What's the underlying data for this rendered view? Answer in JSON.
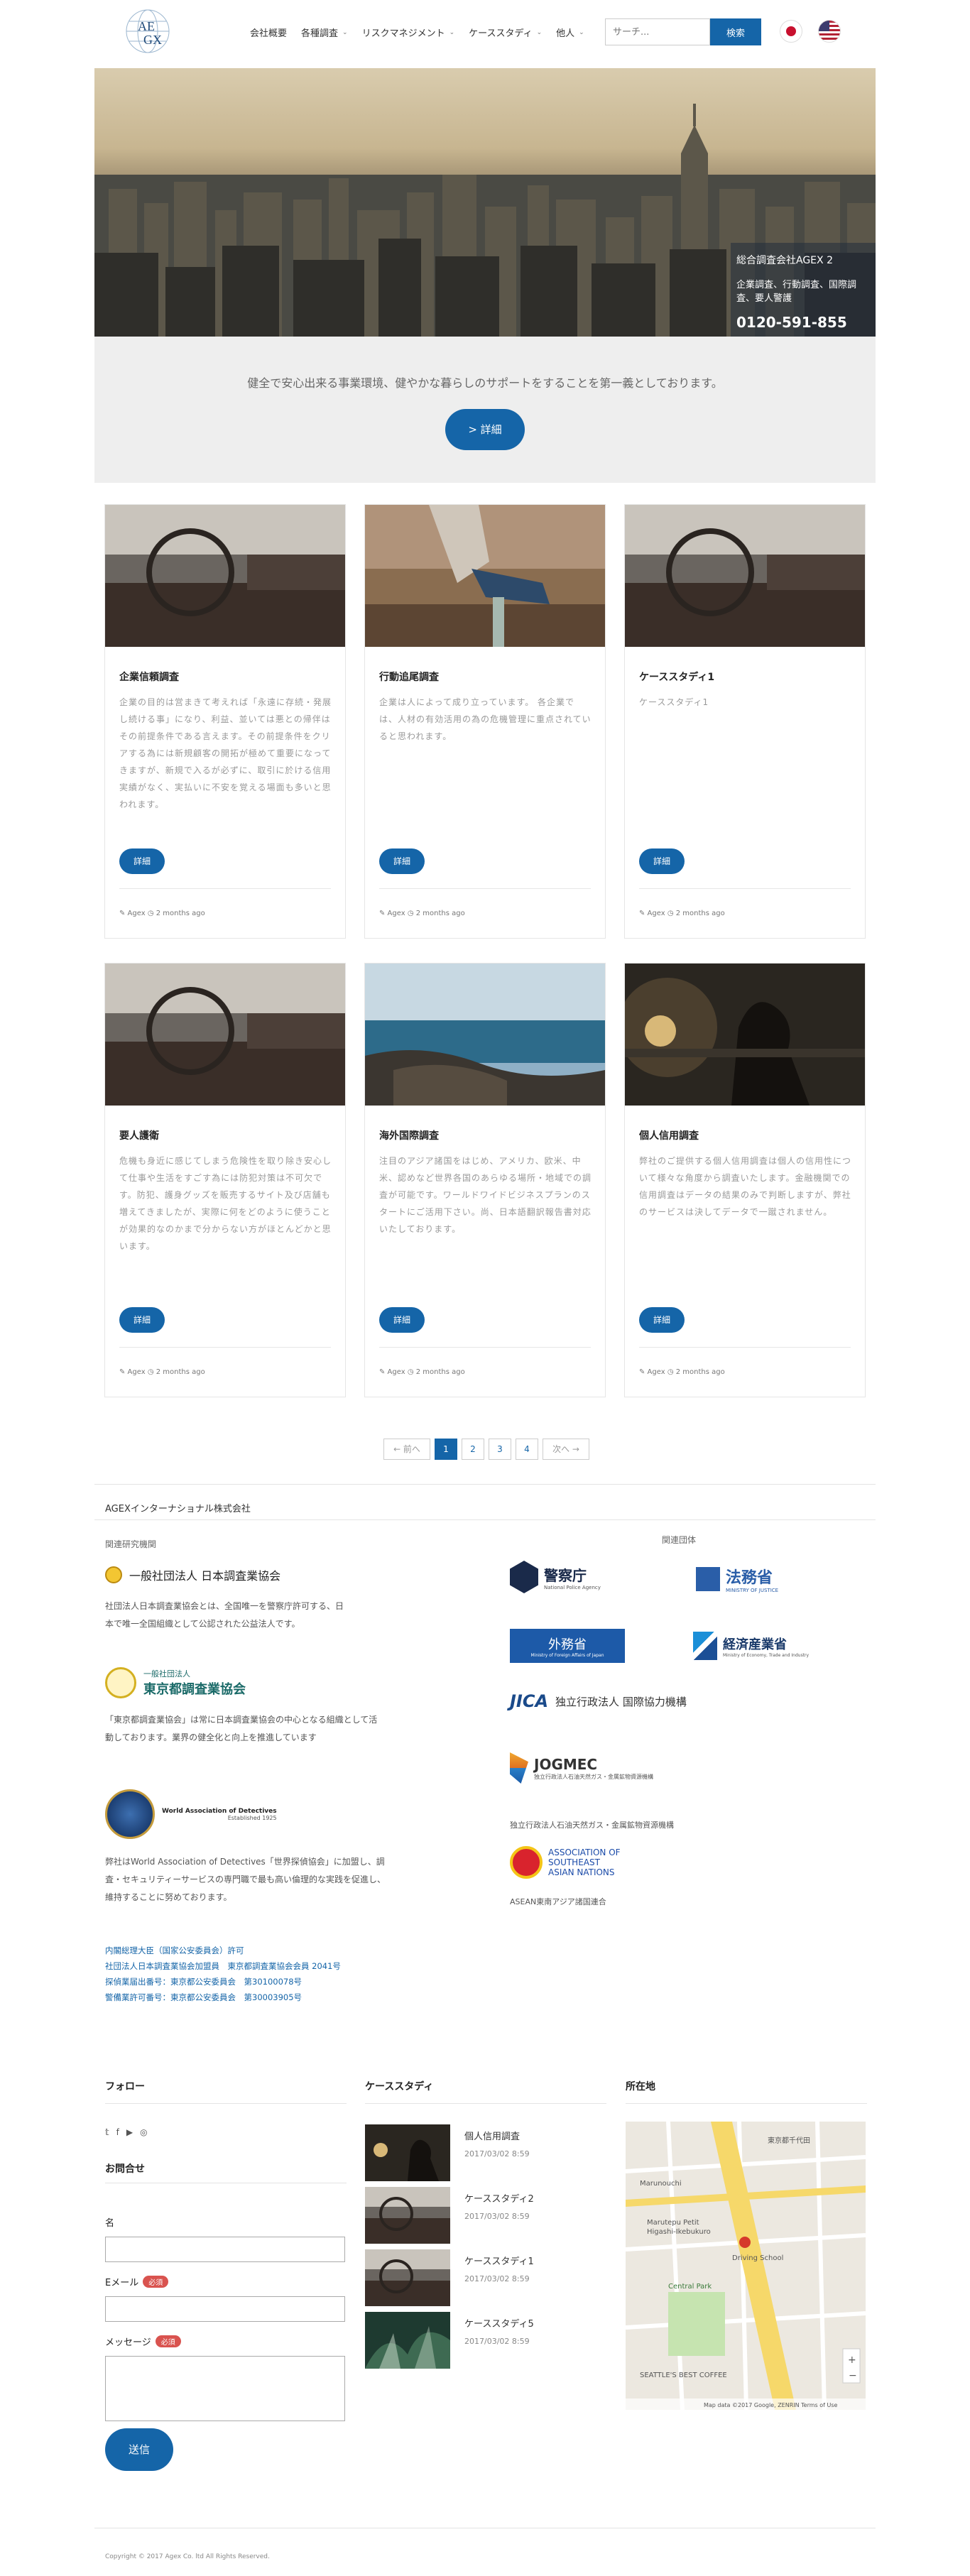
{
  "header": {
    "logo_text": "AEGX",
    "nav": [
      {
        "label": "会社概要",
        "has_menu": false
      },
      {
        "label": "各種調査",
        "has_menu": true
      },
      {
        "label": "リスクマネジメント",
        "has_menu": true
      },
      {
        "label": "ケーススタディ",
        "has_menu": true
      },
      {
        "label": "他人",
        "has_menu": true
      }
    ],
    "search_placeholder": "サーチ...",
    "search_button": "検索"
  },
  "hero": {
    "company": "総合調査会社AGEX 2",
    "services": "企業調査、行動調査、国際調査、要人警護",
    "phone": "0120-591-855",
    "tagline": "健全で安心出来る事業環境、健やかな暮らしのサポートをすることを第一義としております。",
    "detail_button": "> 詳細"
  },
  "cards": [
    {
      "title": "企業信頼調査",
      "excerpt": "企業の目的は営まきて考えれば「永遠に存続・発展し続ける事」になり、利益、並いては悪との帰伴はその前提条件である言えます。その前提条件をクリアする為には新規顧客の開拓が極めて重要になってきますが、新規で入るが必ずに、取引に於ける信用実績がなく、実払いに不安を覚える場面も多いと思われます。",
      "more": "詳細",
      "meta": "✎ Agex ◷ 2 months ago"
    },
    {
      "title": "行動追尾調査",
      "excerpt": "企業は人によって成り立っています。 各企業では、人材の有効活用の為の危機管理に重点されていると思われます。",
      "more": "詳細",
      "meta": "✎ Agex ◷ 2 months ago"
    },
    {
      "title": "ケーススタディ1",
      "excerpt": "ケーススタディ1",
      "more": "詳細",
      "meta": "✎ Agex ◷ 2 months ago"
    },
    {
      "title": "要人護衛",
      "excerpt": "危機も身近に感じてしまう危険性を取り除き安心して仕事や生活をすごす為には防犯対策は不可欠です。防犯、護身グッズを販売するサイト及び店舗も増えてきましたが、実際に何をどのように使うことが効果的なのかまで分からない方がほとんどかと思います。",
      "more": "詳細",
      "meta": "✎ Agex ◷ 2 months ago"
    },
    {
      "title": "海外国際調査",
      "excerpt": "注目のアジア諸国をはじめ、アメリカ、欧米、中米、認めなど世界各国のあらゆる場所・地域での調査が可能です。ワールドワイドビジネスプランのスタートにご活用下さい。尚、日本語翻訳報告書対応いたしております。",
      "more": "詳細",
      "meta": "✎ Agex ◷ 2 months ago"
    },
    {
      "title": "個人信用調査",
      "excerpt": "弊社のご提供する個人信用調査は個人の信用性について様々な角度から調査いたします。金融機関での信用調査はデータの結果のみで判断しますが、弊社のサービスは決してデータで一蹴されません。",
      "more": "詳細",
      "meta": "✎ Agex ◷ 2 months ago"
    }
  ],
  "pagination": {
    "prev": "← 前へ",
    "pages": [
      "1",
      "2",
      "3",
      "4"
    ],
    "current": "1",
    "next": "次へ →"
  },
  "associations": {
    "company": "AGEXインターナショナル株式会社",
    "related_heading": "関連研究機関",
    "groups_heading": "関連団体",
    "jrca_name": "一般社団法人 日本調査業協会",
    "jrca_text": "社団法人日本調査業協会とは、全国唯一を警察庁許可する、日本で唯一全国組織として公認された公益法人です。",
    "tokyo_small": "一般社団法人",
    "tokyo_name": "東京都調査業協会",
    "tokyo_text": "「東京都調査業協会」は常に日本調査業協会の中心となる組織として活動しております。業界の健全化と向上を推進しています",
    "wad_name": "World Association of Detectives",
    "wad_est": "Established 1925",
    "wad_text": "弊社はWorld Association of Detectives「世界探偵協会」に加盟し、調査・セキュリティーサービスの専門職で最も高い倫理的な実践を促進し、維持することに努めております。",
    "links": [
      "内閣総理大臣（国家公安委員会）許可",
      "社団法人日本調査業協会加盟員　東京都調査業協会会員 2041号",
      "探偵業届出番号：東京都公安委員会　第30100078号",
      "警備業許可番号：東京都公安委員会　第30003905号"
    ],
    "gov": {
      "npa": "警察庁",
      "npa_en": "National Police Agency",
      "moj": "法務省",
      "moj_en": "MINISTRY OF JUSTICE",
      "mofa": "外務省",
      "mofa_en": "Ministry of Foreign Affairs of Japan",
      "meti": "経済産業省",
      "meti_en": "Ministry of Economy, Trade and Industry",
      "jica_mark": "JICA",
      "jica": "独立行政法人 国際協力機構",
      "jogmec": "JOGMEC",
      "jogmec_sub": "独立行政法人石油天然ガス・金属鉱物資源機構",
      "jogmec_caption": "独立行政法人石油天然ガス・金属鉱物資源機構",
      "asean": "ASSOCIATION OF SOUTHEAST ASIAN NATIONS",
      "asean_caption": "ASEAN東南アジア諸国連合"
    }
  },
  "footer": {
    "follow_title": "フォロー",
    "social_icons": [
      "twitter-icon",
      "facebook-icon",
      "youtube-icon",
      "instagram-icon"
    ],
    "contact_title": "お問合せ",
    "name_label": "名",
    "email_label": "Eメール",
    "message_label": "メッセージ",
    "required": "必須",
    "send": "送信",
    "cases_title": "ケーススタディ",
    "cases": [
      {
        "title": "個人信用調査",
        "date": "2017/03/02 8:59"
      },
      {
        "title": "ケーススタディ2",
        "date": "2017/03/02 8:59"
      },
      {
        "title": "ケーススタディ1",
        "date": "2017/03/02 8:59"
      },
      {
        "title": "ケーススタディ5",
        "date": "2017/03/02 8:59"
      }
    ],
    "location_title": "所在地",
    "map": {
      "labels": [
        "東京都千代田",
        "Marunouchi",
        "Marutepu Petit",
        "Higashi-Ikebukuro",
        "Central Park",
        "Driving School",
        "SEATTLE'S BEST COFFEE"
      ],
      "attribution": "Map data ©2017 Google, ZENRIN   Terms of Use"
    },
    "copyright": "Copyright © 2017 Agex Co. ltd All Rights Reserved."
  },
  "colors": {
    "accent": "#1565a8",
    "required": "#d9534f"
  }
}
